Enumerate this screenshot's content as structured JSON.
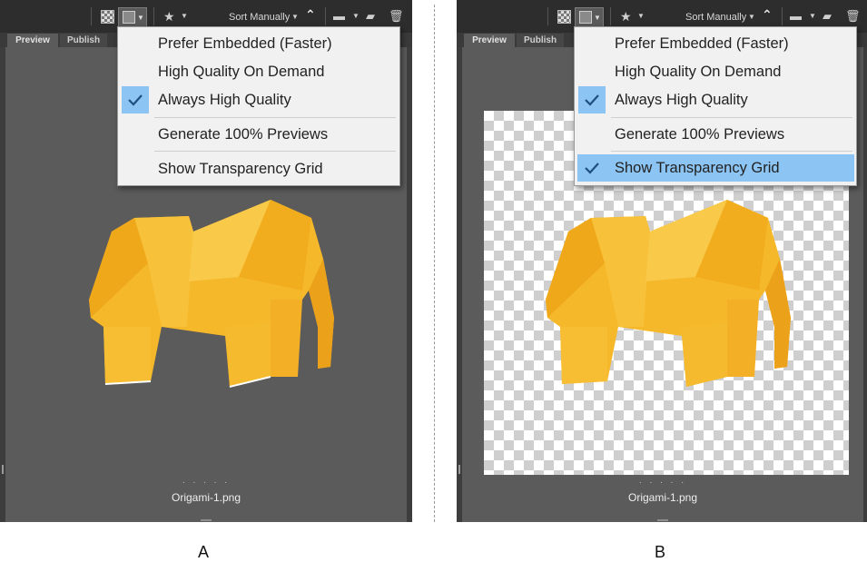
{
  "panels": [
    {
      "caption": "A",
      "toolbar": {
        "sort_label": "Sort Manually"
      },
      "tabs": {
        "preview": "Preview",
        "publish": "Publish"
      },
      "menu": {
        "items": [
          {
            "label": "Prefer Embedded (Faster)",
            "checked": false
          },
          {
            "label": "High Quality On Demand",
            "checked": false
          },
          {
            "label": "Always High Quality",
            "checked": true
          },
          {
            "label": "Generate 100% Previews",
            "checked": false
          },
          {
            "label": "Show Transparency Grid",
            "checked": false
          }
        ]
      },
      "transparency_grid": false,
      "dots": ". . . . .",
      "filename": "Origami-1.png"
    },
    {
      "caption": "B",
      "toolbar": {
        "sort_label": "Sort Manually"
      },
      "tabs": {
        "preview": "Preview",
        "publish": "Publish"
      },
      "menu": {
        "items": [
          {
            "label": "Prefer Embedded (Faster)",
            "checked": false
          },
          {
            "label": "High Quality On Demand",
            "checked": false
          },
          {
            "label": "Always High Quality",
            "checked": true
          },
          {
            "label": "Generate 100% Previews",
            "checked": false
          },
          {
            "label": "Show Transparency Grid",
            "checked": true,
            "highlighted": true
          }
        ]
      },
      "transparency_grid": true,
      "dots": ". . . . .",
      "filename": "Origami-1.png"
    }
  ],
  "colors": {
    "menu_highlight": "#8cc4f3",
    "elephant": "#f5b82a",
    "panel_bg": "#5b5b5b"
  }
}
